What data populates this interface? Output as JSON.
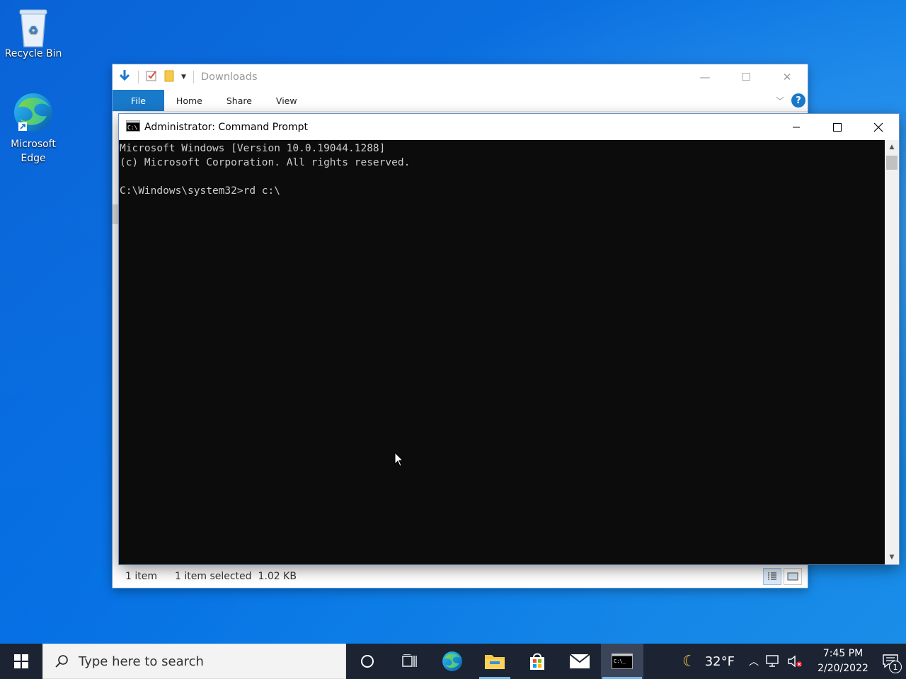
{
  "desktop": {
    "icons": [
      {
        "label": "Recycle Bin"
      },
      {
        "label": "Microsoft Edge"
      }
    ]
  },
  "explorer": {
    "title": "Downloads",
    "tabs": [
      "File",
      "Home",
      "Share",
      "View"
    ],
    "status": {
      "item_count": "1 item",
      "selected": "1 item selected",
      "size": "1.02 KB"
    }
  },
  "cmd": {
    "title": "Administrator: Command Prompt",
    "lines": [
      "Microsoft Windows [Version 10.0.19044.1288]",
      "(c) Microsoft Corporation. All rights reserved.",
      "",
      "C:\\Windows\\system32>rd c:\\"
    ]
  },
  "taskbar": {
    "search_placeholder": "Type here to search",
    "weather_temp": "32°F",
    "time": "7:45 PM",
    "date": "2/20/2022",
    "notification_count": "1"
  }
}
